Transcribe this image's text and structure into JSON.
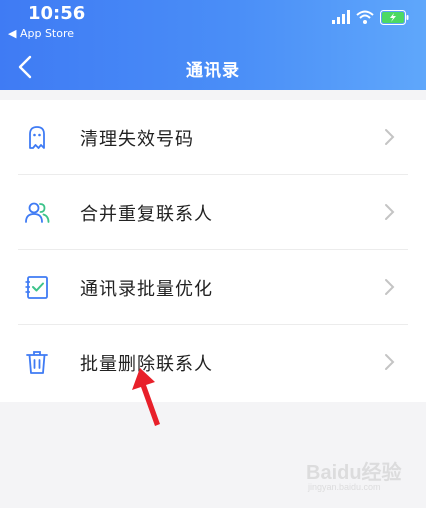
{
  "status_bar": {
    "time": "10:56",
    "back_app": "◀ App Store"
  },
  "header": {
    "title": "通讯录",
    "back_icon": "chevron-left-icon"
  },
  "menu": {
    "items": [
      {
        "label": "清理失效号码",
        "icon": "ghost-icon"
      },
      {
        "label": "合并重复联系人",
        "icon": "users-icon"
      },
      {
        "label": "通讯录批量优化",
        "icon": "checklist-icon"
      },
      {
        "label": "批量删除联系人",
        "icon": "trash-icon"
      }
    ]
  },
  "watermark": {
    "text": "Baidu经验",
    "sub": "jingyan.baidu.com"
  },
  "colors": {
    "header_gradient_start": "#3f7bf4",
    "header_gradient_end": "#5fa7fb",
    "icon_blue": "#3f7bf4",
    "icon_green": "#3cc38a",
    "annotation_red": "#e8202a"
  }
}
